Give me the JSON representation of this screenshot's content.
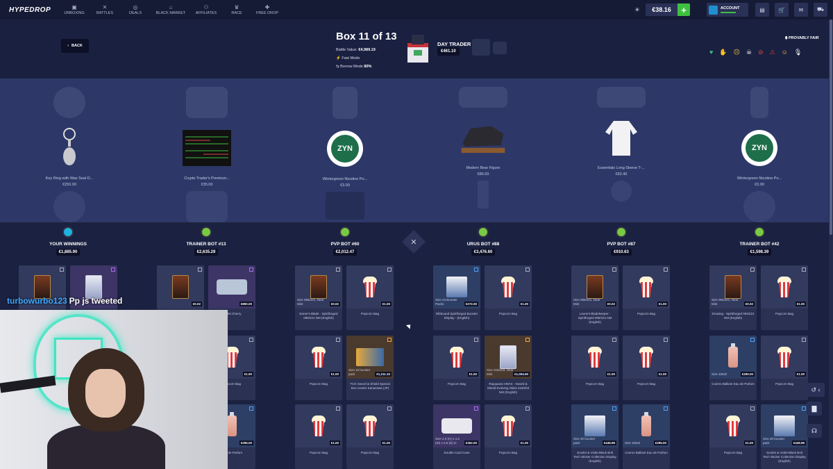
{
  "nav": {
    "logo": "HYPEDROP",
    "items": [
      {
        "label": "UNBOXING",
        "icon": "box-icon"
      },
      {
        "label": "BATTLES",
        "icon": "swords-icon"
      },
      {
        "label": "DEALS",
        "icon": "circle-icon"
      },
      {
        "label": "BLACK MARKET",
        "icon": "market-icon"
      },
      {
        "label": "AFFILIATES",
        "icon": "people-icon"
      },
      {
        "label": "RACE",
        "icon": "trophy-icon"
      },
      {
        "label": "FREE DROP",
        "icon": "gift-icon"
      }
    ],
    "balance": "€38.16",
    "account_label": "ACCOUNT"
  },
  "battle": {
    "back_label": "BACK",
    "title": "Box 11 of 13",
    "value_label": "Battle Value:",
    "value": "€4,989.19",
    "fast_mode": "Fast Mode",
    "borrow_mode": "Borrow Mode",
    "borrow_pct": "80%",
    "box_name": "DAY TRADER",
    "box_price": "€461.10",
    "provably_fair": "PROVABLY FAIR"
  },
  "spinner": [
    {
      "name": "Key Ring with Wax Seal D...",
      "price": "€250.00"
    },
    {
      "name": "Crypto Trader's Premium...",
      "price": "€35.00"
    },
    {
      "name": "Wintergreen Nicotine Po...",
      "price": "€3.00"
    },
    {
      "name": "Modern Bear Figure",
      "price": "€85.00"
    },
    {
      "name": "Essentials Long Sleeve T-...",
      "price": "€92.40"
    },
    {
      "name": "Wintergreen Nicotine Po...",
      "price": "€3.00"
    }
  ],
  "players": [
    {
      "name": "YOUR WINNINGS",
      "value": "€1,885.90"
    },
    {
      "name": "TRAINER BOT #13",
      "value": "€2,635.29"
    },
    {
      "name": "PVP BOT #60",
      "value": "€2,012.47"
    },
    {
      "name": "URUS BOT #88",
      "value": "€3,476.60"
    },
    {
      "name": "PVP BOT #87",
      "value": "€910.63"
    },
    {
      "name": "TRAINER BOT #42",
      "value": "€1,598.39"
    }
  ],
  "cards": [
    {
      "name": "Popcorn Bag",
      "price": "€1.00",
      "det": ""
    },
    {
      "name": "Wallet Cherry",
      "price": "€890.00",
      "det": ""
    },
    {
      "name": "Doner's Blade - Spiritforged 095/221 NM (English)",
      "price": "€0.02",
      "det": "Size 095/221, Near Mint"
    },
    {
      "name": "TCG Sword & Shield Special Box Center Kanazawa (JP)",
      "price": "€1,211.10",
      "det": "Size 10 booster pack"
    },
    {
      "name": "Ribbound Spiritforged Booster Display - (English)",
      "price": "€272.00",
      "det": "Size 24 Booster Packs"
    },
    {
      "name": "Rayquaza VMAX - Sword & Shield Evolving Skies 218/203 NM (English)",
      "price": "€1,004.50",
      "det": "Size 218/203, Near Mint"
    },
    {
      "name": "Double Card Case",
      "price": "€352.00",
      "det": "Size 2.0 (H) x 4.3 (W) x 0.6 (D) in"
    },
    {
      "name": "Laurent Bladekeeper - Spiritforged 096/221 NM (English)",
      "price": "€0.02",
      "det": "Size 096/221, Near Mint"
    },
    {
      "name": "Scarlet & Violet Black Bolt Tech Sticker Collection Display (English)",
      "price": "€449.99",
      "det": "Size 30 booster pack"
    },
    {
      "name": "Cosmo Balliant Eau de Parfum",
      "price": "€295.00",
      "det": "Size 100ml"
    },
    {
      "name": "Drowing - Spiritforged 094/221 NM (English)",
      "price": "€0.02",
      "det": "Size 094/221, Near Mint"
    },
    {
      "name": "Cosmo Balliant Eau de Parfum",
      "price": "€290.00",
      "det": "Size 100ml"
    },
    {
      "name": "Scarlet & Violet Black Bolt Tech Sticker Collection Display (English)",
      "price": "€449.99",
      "det": "Size 30 booster pack"
    },
    {
      "name": "Eau de Parfum",
      "price": "€295.00",
      "det": ""
    }
  ],
  "stream": {
    "username": "turbowurbo123",
    "message": "Pp js tweeted"
  }
}
